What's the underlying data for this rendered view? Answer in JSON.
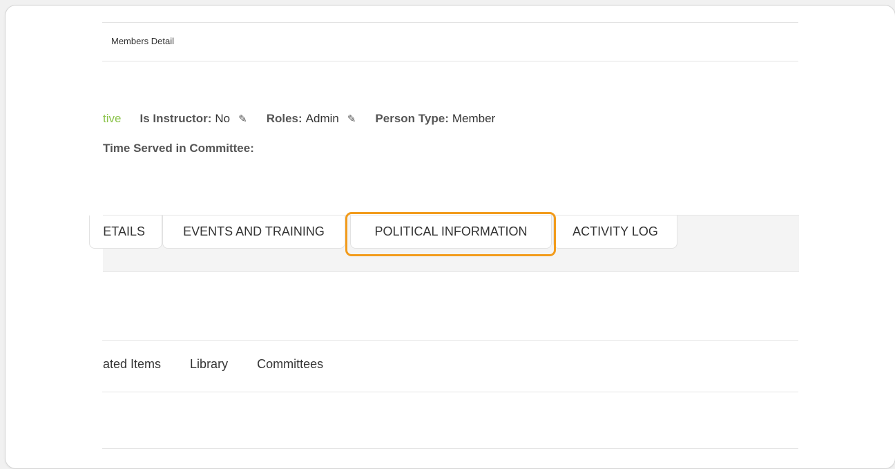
{
  "header": {
    "breadcrumb": "Members Detail"
  },
  "profile": {
    "status": "tive",
    "instructor_label": "Is Instructor:",
    "instructor_value": "No",
    "roles_label": "Roles:",
    "roles_value": "Admin",
    "person_type_label": "Person Type:",
    "person_type_value": "Member",
    "time_served_label": "Time Served in Committee:"
  },
  "tabs": [
    {
      "label": "ETAILS"
    },
    {
      "label": "EVENTS AND TRAINING"
    },
    {
      "label": "POLITICAL INFORMATION",
      "highlighted": true
    },
    {
      "label": "ACTIVITY LOG"
    }
  ],
  "subnav": [
    {
      "label": "ated Items"
    },
    {
      "label": "Library"
    },
    {
      "label": "Committees"
    }
  ],
  "colors": {
    "status_active": "#8bc34a",
    "highlight": "#f29b1b"
  }
}
